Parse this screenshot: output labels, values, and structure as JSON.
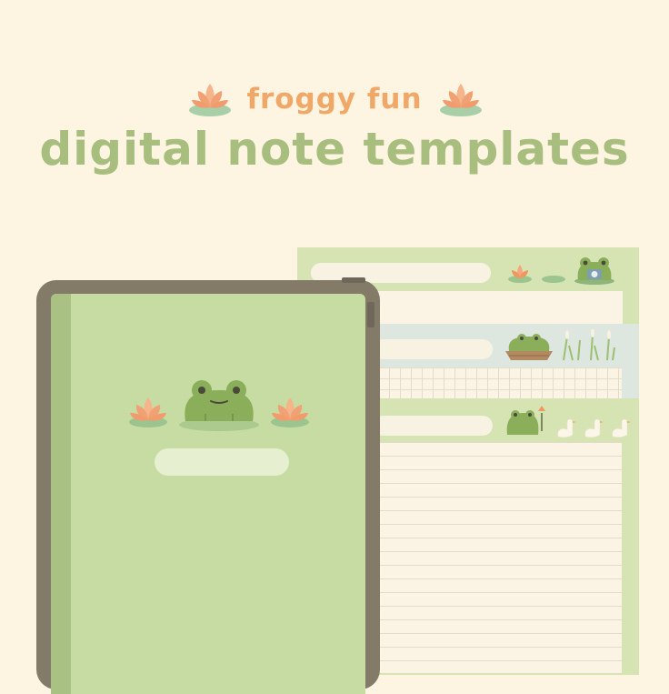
{
  "header": {
    "subtitle": "froggy fun",
    "title": "digital note templates"
  },
  "icons": {
    "top_left": "lotus-icon",
    "top_right": "lotus-icon",
    "cover_frog": "frog-icon",
    "cover_lotus": "lotus-icon",
    "duck": "duck-icon",
    "reeds": "reed-icon"
  },
  "colors": {
    "background": "#fdf4e2",
    "subtitle": "#f0a868",
    "title": "#a8be7e",
    "tablet_frame": "#847a68",
    "cover": "#c7dca3",
    "page_header": "#d6e4b4",
    "frog": "#8aae5a",
    "lotus": "#f4a77e"
  }
}
